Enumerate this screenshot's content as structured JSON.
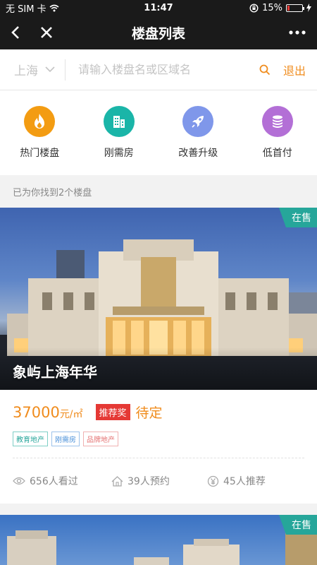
{
  "status_bar": {
    "carrier": "无 SIM 卡",
    "time": "11:47",
    "battery": "15%",
    "battery_level": 0.15
  },
  "nav": {
    "title": "楼盘列表"
  },
  "search": {
    "city": "上海",
    "placeholder": "请输入楼盘名或区域名",
    "value": "",
    "exit_label": "退出"
  },
  "categories": [
    {
      "label": "热门楼盘",
      "icon": "flame-icon",
      "color": "#f39c12"
    },
    {
      "label": "刚需房",
      "icon": "building-icon",
      "color": "#1ab5a8"
    },
    {
      "label": "改善升级",
      "icon": "rocket-icon",
      "color": "#7f97ea"
    },
    {
      "label": "低首付",
      "icon": "coins-icon",
      "color": "#b36fd6"
    }
  ],
  "result_count_text": "已为你找到2个楼盘",
  "listings": [
    {
      "name": "象屿上海年华",
      "status": "在售",
      "price": "37000",
      "price_unit": "元/㎡",
      "reco_badge": "推荐奖",
      "reco_status": "待定",
      "tags": [
        "教育地产",
        "刚需房",
        "品牌地产"
      ],
      "views": "656人看过",
      "bookings": "39人预约",
      "recommends": "45人推荐"
    },
    {
      "status": "在售"
    }
  ],
  "colors": {
    "accent": "#f08c1d",
    "nav_bg": "#1a1a1a",
    "status_green": "#26a69a",
    "badge_red": "#e53935"
  }
}
